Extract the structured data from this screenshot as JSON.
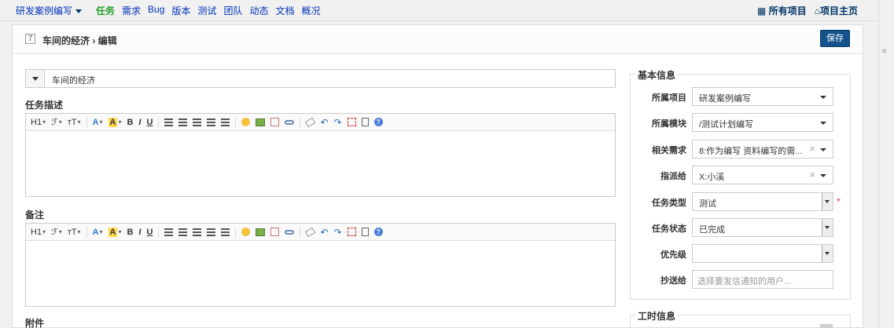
{
  "nav": {
    "project": "研发案例编写",
    "items": [
      "任务",
      "需求",
      "Bug",
      "版本",
      "测试",
      "团队",
      "动态",
      "文档",
      "概况"
    ],
    "all_projects": "所有项目",
    "project_home": "项目主页"
  },
  "header": {
    "id": "7",
    "breadcrumb": "车间的经济 › 编辑",
    "save_label": "保存"
  },
  "form": {
    "title_value": "车间的经济",
    "desc_label": "任务描述",
    "note_label": "备注",
    "attach_label": "附件"
  },
  "toolbar": {
    "heading": "H1",
    "font": "ℱ",
    "size": "тT",
    "font_color": "A",
    "bg_color": "A",
    "bold": "B",
    "italic": "I",
    "underline": "U"
  },
  "basic": {
    "legend": "基本信息",
    "fields": [
      {
        "label": "所属项目",
        "value": "研发案例编写"
      },
      {
        "label": "所属模块",
        "value": "/测试计划编写"
      },
      {
        "label": "相关需求",
        "value": "8:作为编写 资料编写的需..."
      },
      {
        "label": "指派给",
        "value": "X:小溪"
      },
      {
        "label": "任务类型",
        "value": "测试"
      },
      {
        "label": "任务状态",
        "value": "已完成"
      },
      {
        "label": "优先级",
        "value": ""
      },
      {
        "label": "抄送给",
        "placeholder": "选择要发信通知的用户..."
      }
    ],
    "required_mark": "*",
    "clear_mark": "×"
  },
  "time": {
    "legend": "工时信息"
  },
  "colors": {
    "accent": "#14528b",
    "active_nav": "#229f24",
    "required": "#dd3333"
  }
}
